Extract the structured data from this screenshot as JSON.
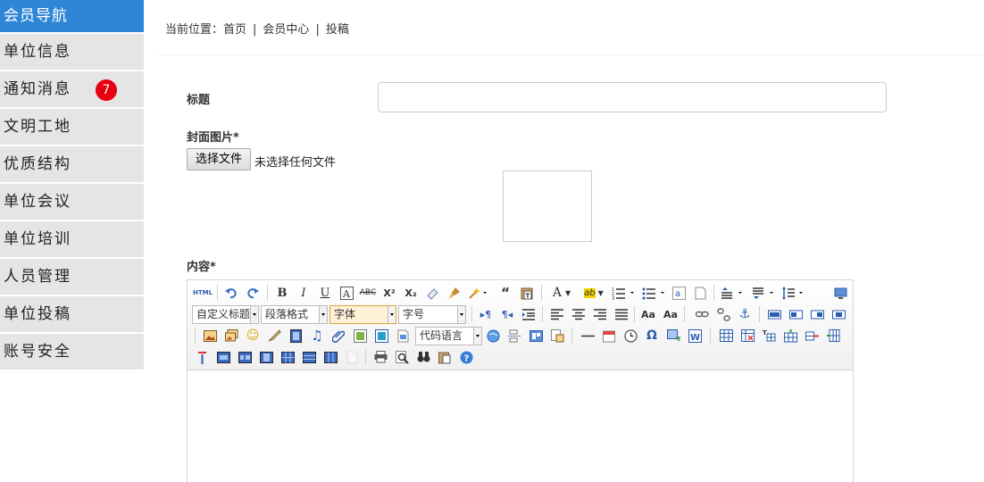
{
  "sidebar": {
    "header": "会员导航",
    "items": [
      {
        "label": "单位信息"
      },
      {
        "label": "通知消息",
        "badge": "7"
      },
      {
        "label": "文明工地"
      },
      {
        "label": "优质结构"
      },
      {
        "label": "单位会议"
      },
      {
        "label": "单位培训"
      },
      {
        "label": "人员管理"
      },
      {
        "label": "单位投稿"
      },
      {
        "label": "账号安全"
      }
    ]
  },
  "breadcrumb": {
    "prefix": "当前位置：",
    "items": [
      "首页",
      "会员中心",
      "投稿"
    ],
    "separator": "|"
  },
  "form": {
    "title_label": "标题",
    "title_value": "",
    "cover_label": "封面图片*",
    "file_button": "选择文件",
    "file_status": "未选择任何文件",
    "content_label": "内容*"
  },
  "editor": {
    "html_button": "HTML",
    "combos": {
      "custom_title": "自定义标题",
      "paragraph": "段落格式",
      "font": "字体",
      "font_size": "字号",
      "code_lang": "代码语言"
    }
  },
  "colors": {
    "nav_header_bg": "#2f86d6",
    "nav_item_bg": "#e5e5e5",
    "badge_bg": "#e60012"
  }
}
